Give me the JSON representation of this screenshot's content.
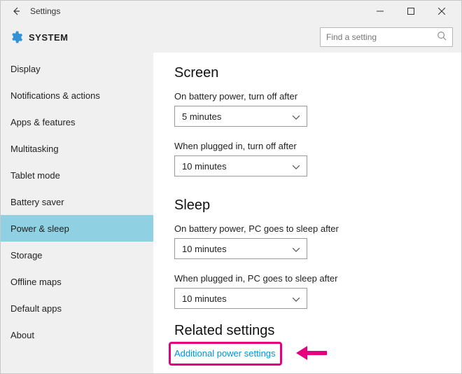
{
  "window": {
    "title": "Settings"
  },
  "header": {
    "section": "SYSTEM",
    "search_placeholder": "Find a setting"
  },
  "sidebar": {
    "items": [
      {
        "label": "Display"
      },
      {
        "label": "Notifications & actions"
      },
      {
        "label": "Apps & features"
      },
      {
        "label": "Multitasking"
      },
      {
        "label": "Tablet mode"
      },
      {
        "label": "Battery saver"
      },
      {
        "label": "Power & sleep"
      },
      {
        "label": "Storage"
      },
      {
        "label": "Offline maps"
      },
      {
        "label": "Default apps"
      },
      {
        "label": "About"
      }
    ],
    "selected_index": 6
  },
  "content": {
    "screen": {
      "heading": "Screen",
      "battery_label": "On battery power, turn off after",
      "battery_value": "5 minutes",
      "plugged_label": "When plugged in, turn off after",
      "plugged_value": "10 minutes"
    },
    "sleep": {
      "heading": "Sleep",
      "battery_label": "On battery power, PC goes to sleep after",
      "battery_value": "10 minutes",
      "plugged_label": "When plugged in, PC goes to sleep after",
      "plugged_value": "10 minutes"
    },
    "related": {
      "heading": "Related settings",
      "link": "Additional power settings"
    }
  }
}
